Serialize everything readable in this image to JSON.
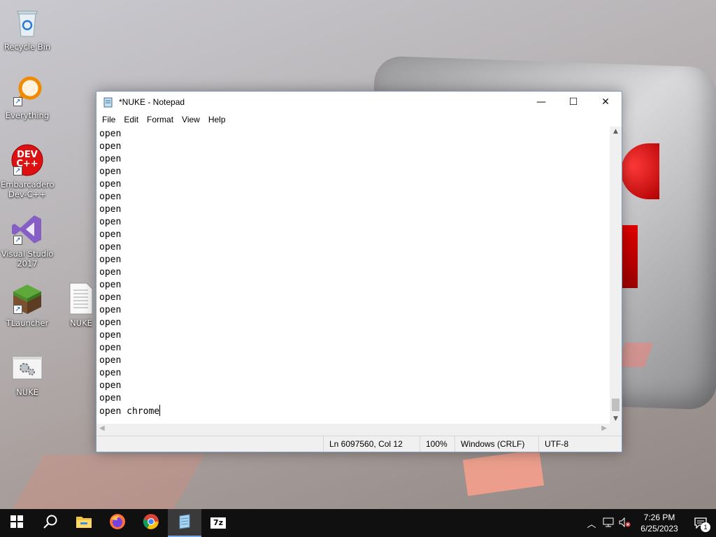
{
  "desktop": {
    "icons": [
      {
        "label": "Recycle Bin",
        "icon": "recycle-bin-icon"
      },
      {
        "label": "Everything",
        "icon": "search-magnifier-icon"
      },
      {
        "label": "Embarcadero Dev-C++",
        "icon": "devcpp-icon",
        "badge_text": "DEV C++"
      },
      {
        "label": "Visual Studio 2017",
        "icon": "visual-studio-icon"
      },
      {
        "label": "TLauncher",
        "icon": "minecraft-block-icon"
      },
      {
        "label": "NUKE",
        "icon": "text-file-icon"
      },
      {
        "label": "NUKE",
        "icon": "batch-file-gear-icon"
      }
    ]
  },
  "notepad": {
    "title": "*NUKE - Notepad",
    "menu": [
      "File",
      "Edit",
      "Format",
      "View",
      "Help"
    ],
    "lines": [
      "open",
      "open",
      "open",
      "open",
      "open",
      "open",
      "open",
      "open",
      "open",
      "open",
      "open",
      "open",
      "open",
      "open",
      "open",
      "open",
      "open",
      "open",
      "open",
      "open",
      "open",
      "open"
    ],
    "last_line": "open chrome",
    "status": {
      "position": "Ln 6097560, Col 12",
      "zoom": "100%",
      "line_ending": "Windows (CRLF)",
      "encoding": "UTF-8"
    },
    "controls": {
      "minimize": "—",
      "maximize": "☐",
      "close": "✕"
    }
  },
  "taskbar": {
    "apps": [
      "start-icon",
      "search-icon",
      "file-explorer-icon",
      "firefox-icon",
      "chrome-icon",
      "notepad-icon",
      "7zip-icon"
    ],
    "active_app": "notepad-icon",
    "sevenzip_label": "7z",
    "clock": {
      "time": "7:26 PM",
      "date": "6/25/2023"
    },
    "notification_count": "1"
  }
}
